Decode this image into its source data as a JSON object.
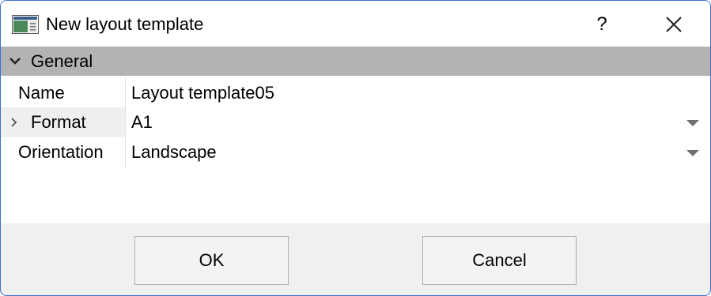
{
  "window": {
    "title": "New layout template",
    "help_label": "?"
  },
  "group": {
    "label": "General"
  },
  "properties": [
    {
      "name": "Name",
      "value": "Layout template05"
    },
    {
      "name": "Format",
      "value": "A1"
    },
    {
      "name": "Orientation",
      "value": "Landscape"
    }
  ],
  "buttons": {
    "ok_label": "OK",
    "cancel_label": "Cancel"
  },
  "colors": {
    "accent_border": "#3f6fd0",
    "group_header_bg": "#b3b3b3",
    "footer_bg": "#f0f0f0"
  }
}
